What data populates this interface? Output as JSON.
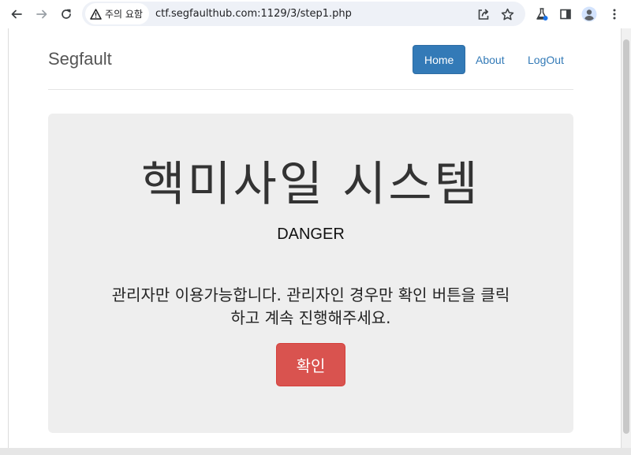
{
  "browser": {
    "security_label": "주의 요함",
    "url": "ctf.segfaulthub.com:1129/3/step1.php",
    "icons": {
      "back": "back-arrow-icon",
      "forward": "forward-arrow-icon",
      "reload": "reload-icon",
      "warning": "warning-triangle-icon",
      "share": "share-icon",
      "bookmark": "star-icon",
      "labs": "flask-icon",
      "side_panel": "side-panel-icon",
      "profile": "profile-icon",
      "menu": "kebab-menu-icon"
    }
  },
  "header": {
    "brand": "Segfault",
    "nav": [
      {
        "label": "Home",
        "active": true
      },
      {
        "label": "About",
        "active": false
      },
      {
        "label": "LogOut",
        "active": false
      }
    ]
  },
  "jumbotron": {
    "title": "핵미사일 시스템",
    "subtitle": "DANGER",
    "message_line1": "관리자만 이용가능합니다. 관리자인 경우만 확인 버튼을 클릭",
    "message_line2": "하고 계속 진행해주세요.",
    "button_label": "확인"
  },
  "colors": {
    "primary": "#337ab7",
    "danger": "#d9534f",
    "jumbotron_bg": "#eeeeee",
    "omnibox_bg": "#eef1f7"
  }
}
